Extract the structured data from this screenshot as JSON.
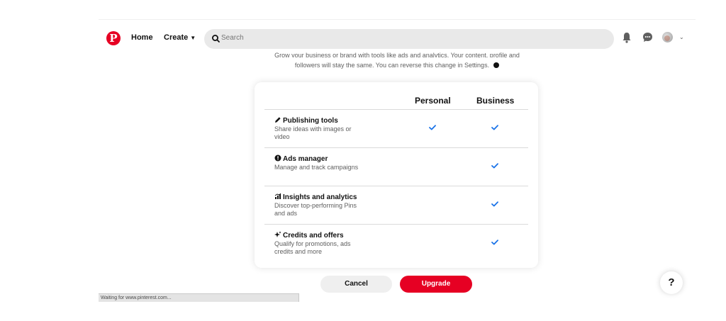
{
  "topbar": {
    "logo_letter": "P",
    "home_label": "Home",
    "create_label": "Create",
    "search_placeholder": "Search"
  },
  "intro": {
    "line1": "Grow your business or brand with tools like ads and analytics. Your content, profile and",
    "line2": "followers will stay the same. You can reverse this change in Settings."
  },
  "comparison": {
    "columns": [
      "Personal",
      "Business"
    ],
    "rows": [
      {
        "title": "Publishing tools",
        "icon": "pencil-icon",
        "description": "Share ideas with images or video",
        "personal": true,
        "business": true
      },
      {
        "title": "Ads manager",
        "icon": "megaphone-icon",
        "description": "Manage and track campaigns",
        "personal": false,
        "business": true
      },
      {
        "title": "Insights and analytics",
        "icon": "bar-chart-icon",
        "description": "Discover top-performing Pins and ads",
        "personal": false,
        "business": true
      },
      {
        "title": "Credits and offers",
        "icon": "sparkle-icon",
        "description": "Qualify for promotions, ads credits and more",
        "personal": false,
        "business": true
      }
    ]
  },
  "actions": {
    "cancel_label": "Cancel",
    "upgrade_label": "Upgrade"
  },
  "help_label": "?",
  "status_text": "Waiting for www.pinterest.com...",
  "colors": {
    "brand_red": "#e60023",
    "check_blue": "#1a73e8",
    "search_bg": "#e9e9e9"
  }
}
